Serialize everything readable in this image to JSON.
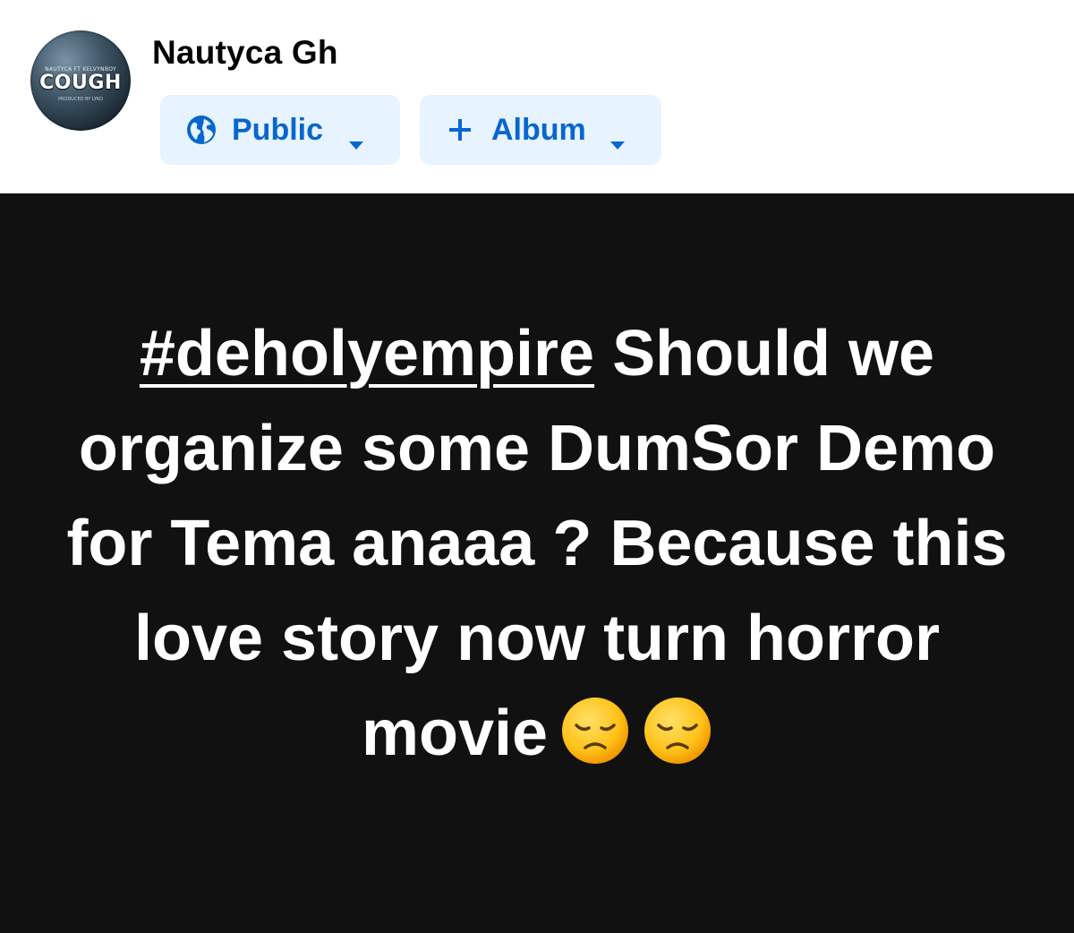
{
  "author": {
    "name": "Nautyca Gh",
    "avatar": {
      "title_text": "COUGH",
      "small_top_text": "NAUTYCA FT KELVYNBOY",
      "small_bottom_text": "PRODUCED BY LYKO"
    }
  },
  "audience_selector": {
    "label": "Public",
    "icon": "globe-icon",
    "dropdown_icon": "caret-down-icon"
  },
  "album_selector": {
    "label": "Album",
    "icon": "plus-icon",
    "dropdown_icon": "caret-down-icon"
  },
  "post": {
    "background_color": "#111111",
    "text_color": "#ffffff",
    "hashtag": "#deholyempire",
    "body": " Should we organize some DumSor Demo for Tema anaaa ? Because this love story now turn horror movie",
    "emojis": [
      "disappointed-face-icon",
      "disappointed-face-icon"
    ]
  },
  "colors": {
    "accent": "#0866cf",
    "pill_background": "#e7f3ff"
  }
}
